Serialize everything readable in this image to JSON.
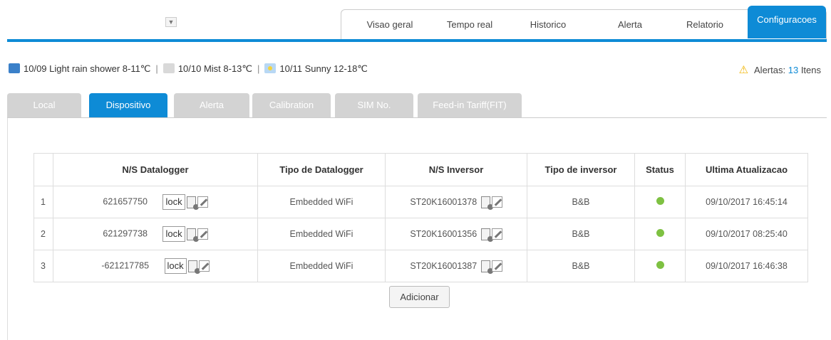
{
  "nav": {
    "collapse_glyph": "▼",
    "tabs": [
      {
        "label": "Visao geral"
      },
      {
        "label": "Tempo real"
      },
      {
        "label": "Historico"
      },
      {
        "label": "Alerta"
      },
      {
        "label": "Relatorio"
      },
      {
        "label": "Configuracoes",
        "active": true
      }
    ]
  },
  "weather": [
    {
      "icon": "cloud-rain-icon",
      "text": "10/09 Light rain shower 8-11℃"
    },
    {
      "icon": "mist-icon",
      "text": "10/10 Mist 8-13℃"
    },
    {
      "icon": "sunny-icon",
      "text": "10/11 Sunny 12-18℃"
    }
  ],
  "weather_separator": "|",
  "alerts": {
    "icon": "warning-icon",
    "label": "Alertas:",
    "count": "13",
    "suffix": "Itens"
  },
  "sub_tabs": [
    {
      "label": "Local"
    },
    {
      "label": "Dispositivo",
      "active": true
    },
    {
      "label": "Alerta"
    },
    {
      "label": "Calibration"
    },
    {
      "label": "SIM No."
    },
    {
      "label": "Feed-in Tariff(FIT)"
    }
  ],
  "table": {
    "headers": [
      "",
      "N/S Datalogger",
      "Tipo de Datalogger",
      "N/S Inversor",
      "Tipo de inversor",
      "Status",
      "Ultima Atualizacao"
    ],
    "lock_label": "lock",
    "rows": [
      {
        "n": "1",
        "datalogger": "621657750",
        "type": "Embedded WiFi",
        "inverter": "ST20K16001378",
        "inv_type": "B&B",
        "status": "ok",
        "updated": "09/10/2017 16:45:14"
      },
      {
        "n": "2",
        "datalogger": "621297738",
        "type": "Embedded WiFi",
        "inverter": "ST20K16001356",
        "inv_type": "B&B",
        "status": "ok",
        "updated": "09/10/2017 08:25:40"
      },
      {
        "n": "3",
        "datalogger": "-621217785",
        "type": "Embedded WiFi",
        "inverter": "ST20K16001387",
        "inv_type": "B&B",
        "status": "ok",
        "updated": "09/10/2017 16:46:38"
      }
    ]
  },
  "add_button": "Adicionar",
  "colors": {
    "accent": "#0e8bd6",
    "tab_inactive": "#d3d3d3",
    "status_ok": "#7ec142",
    "warning": "#f0b400"
  }
}
